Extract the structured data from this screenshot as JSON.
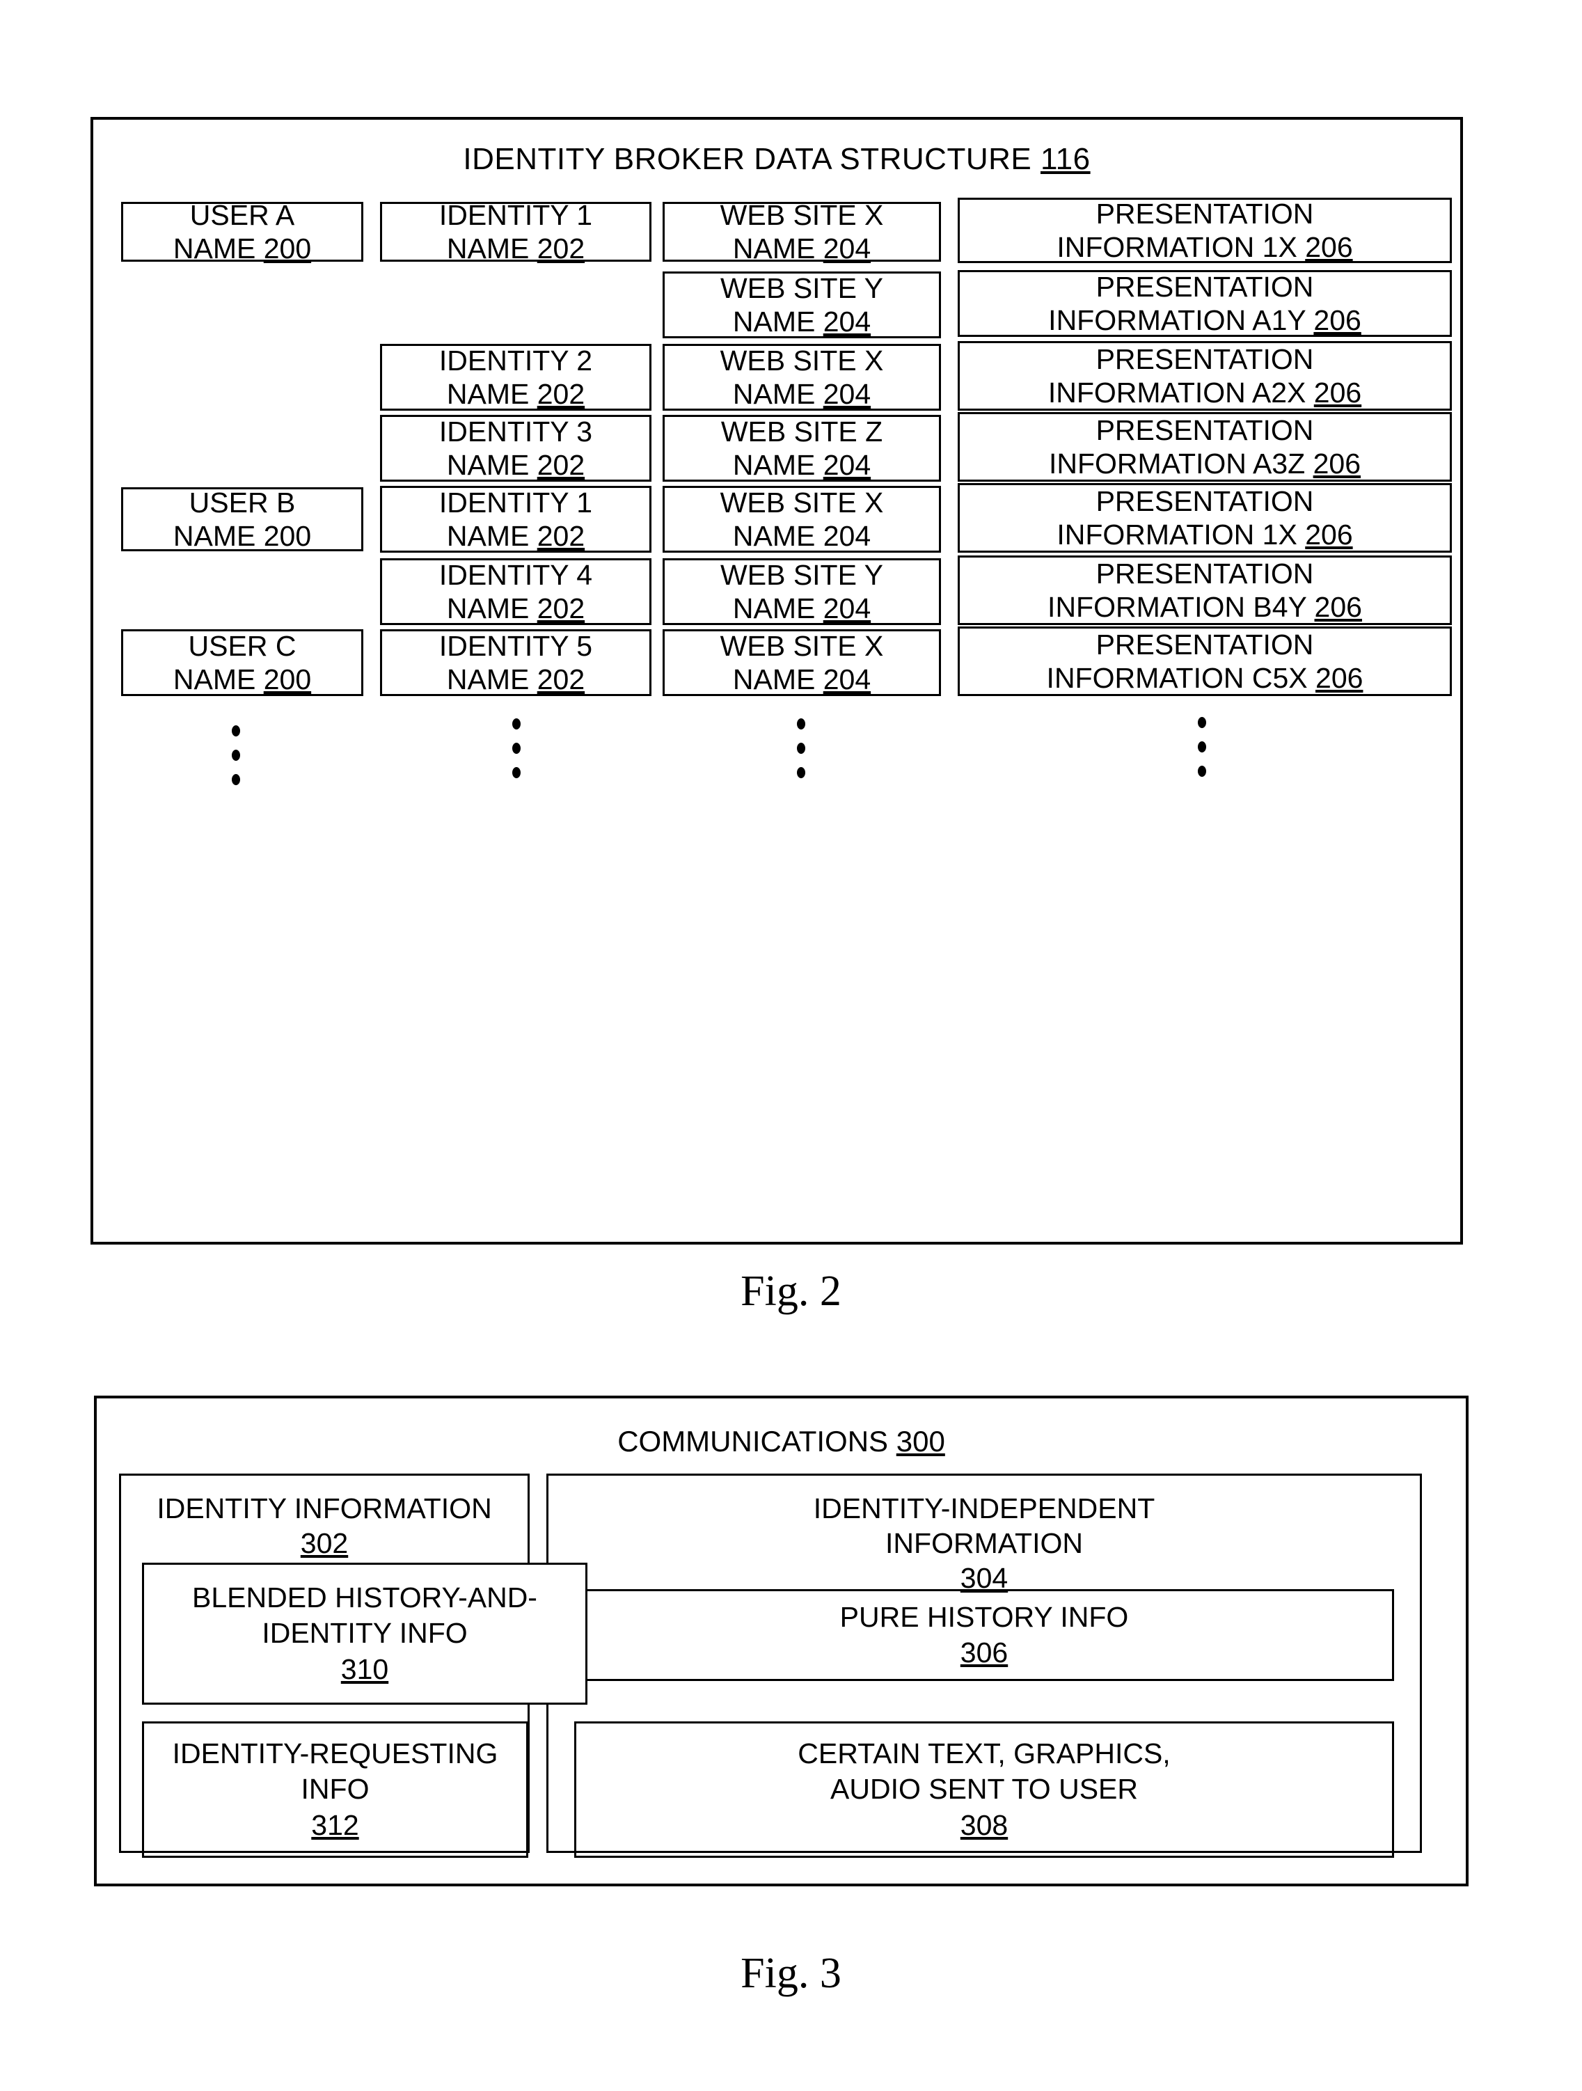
{
  "figure2": {
    "caption": "Fig. 2",
    "title": "IDENTITY BROKER DATA STRUCTURE",
    "title_ref": "116",
    "columns": [
      "user",
      "identity",
      "website",
      "presentation"
    ],
    "rows": [
      {
        "user": {
          "line1": "USER A",
          "line2": "NAME ",
          "ref": "200"
        },
        "identity": {
          "line1": "IDENTITY 1",
          "line2": "NAME ",
          "ref": "202"
        },
        "website": {
          "line1": "WEB SITE X",
          "line2": "NAME ",
          "ref": "204"
        },
        "presentation": {
          "line1": "PRESENTATION",
          "line2": "INFORMATION 1X ",
          "ref": "206"
        }
      },
      {
        "user": null,
        "identity": null,
        "website": {
          "line1": "WEB SITE Y",
          "line2": "NAME ",
          "ref": "204"
        },
        "presentation": {
          "line1": "PRESENTATION",
          "line2": "INFORMATION A1Y ",
          "ref": "206"
        }
      },
      {
        "user": null,
        "identity": {
          "line1": "IDENTITY 2",
          "line2": "NAME ",
          "ref": "202"
        },
        "website": {
          "line1": "WEB SITE X",
          "line2": "NAME ",
          "ref": "204"
        },
        "presentation": {
          "line1": "PRESENTATION",
          "line2": "INFORMATION A2X ",
          "ref": "206"
        }
      },
      {
        "user": null,
        "identity": {
          "line1": "IDENTITY 3",
          "line2": "NAME ",
          "ref": "202"
        },
        "website": {
          "line1": "WEB SITE Z",
          "line2": "NAME ",
          "ref": "204"
        },
        "presentation": {
          "line1": "PRESENTATION",
          "line2": "INFORMATION A3Z ",
          "ref": "206"
        }
      },
      {
        "user": {
          "line1": "USER B",
          "line2": "NAME ",
          "ref": "200"
        },
        "identity": {
          "line1": "IDENTITY 1",
          "line2": "NAME ",
          "ref": "202"
        },
        "website": {
          "line1": "WEB SITE X",
          "line2": "NAME ",
          "ref": "204"
        },
        "presentation": {
          "line1": "PRESENTATION",
          "line2": "INFORMATION 1X ",
          "ref": "206"
        }
      },
      {
        "user": null,
        "identity": {
          "line1": "IDENTITY 4",
          "line2": "NAME ",
          "ref": "202"
        },
        "website": {
          "line1": "WEB SITE Y",
          "line2": "NAME ",
          "ref": "204"
        },
        "presentation": {
          "line1": "PRESENTATION",
          "line2": "INFORMATION B4Y ",
          "ref": "206"
        }
      },
      {
        "user": {
          "line1": "USER C",
          "line2": "NAME ",
          "ref": "200"
        },
        "identity": {
          "line1": "IDENTITY 5",
          "line2": "NAME ",
          "ref": "202"
        },
        "website": {
          "line1": "WEB SITE X",
          "line2": "NAME ",
          "ref": "204"
        },
        "presentation": {
          "line1": "PRESENTATION",
          "line2": "INFORMATION C5X ",
          "ref": "206"
        }
      }
    ],
    "continuation_marker": "vertical-ellipsis"
  },
  "figure3": {
    "caption": "Fig. 3",
    "title": "COMMUNICATIONS",
    "title_ref": "300",
    "left_panel": {
      "title_line1": "IDENTITY INFORMATION ",
      "title_ref": "302",
      "boxes": [
        {
          "line1": "BLENDED HISTORY-AND-",
          "line2": "IDENTITY INFO ",
          "ref": "310"
        },
        {
          "line1": "IDENTITY-REQUESTING",
          "line2": "INFO ",
          "ref": "312"
        }
      ]
    },
    "right_panel": {
      "title_line1": "IDENTITY-INDEPENDENT",
      "title_line2": "INFORMATION ",
      "title_ref": "304",
      "boxes": [
        {
          "line1": "PURE HISTORY INFO ",
          "line2": "",
          "ref": "306"
        },
        {
          "line1": "CERTAIN TEXT, GRAPHICS,",
          "line2": "AUDIO SENT TO USER ",
          "ref": "308"
        }
      ]
    }
  },
  "colors": {
    "ink": "#000000",
    "paper": "#ffffff"
  }
}
